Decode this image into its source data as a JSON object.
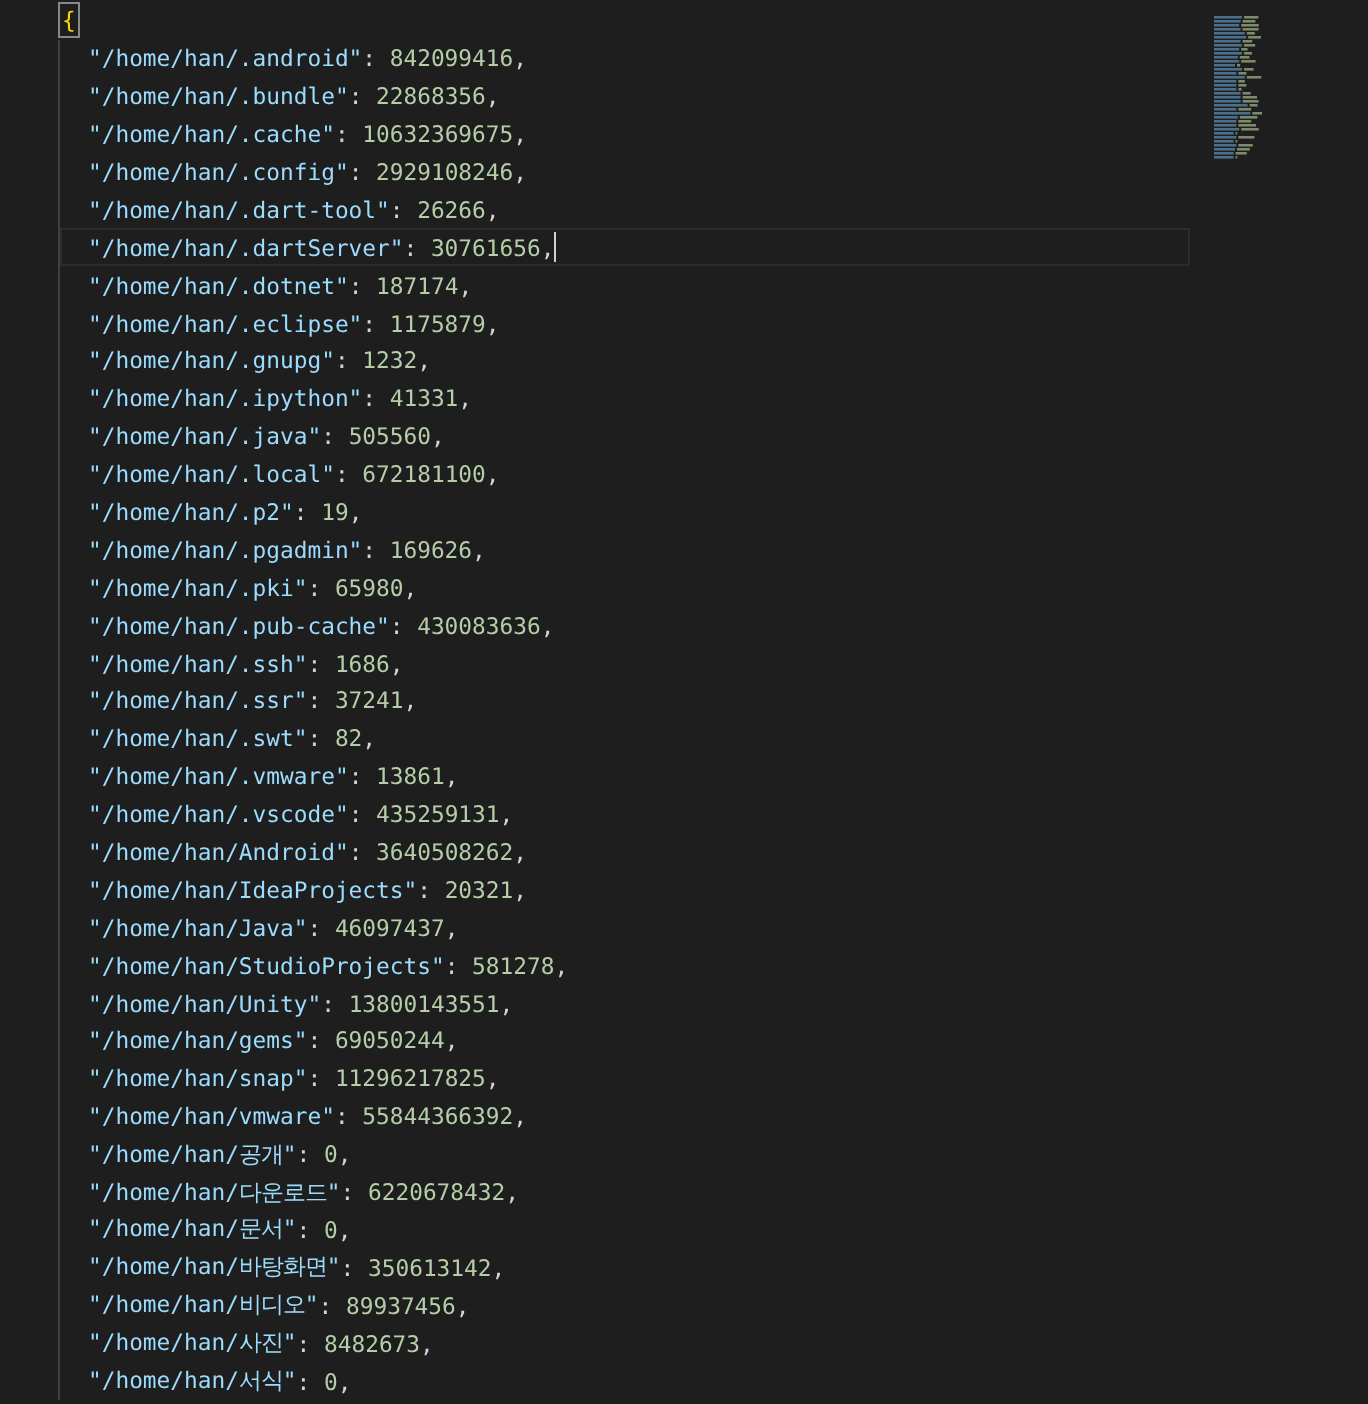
{
  "editor": {
    "open_brace": "{",
    "entries": [
      {
        "key": "\"/home/han/.android\"",
        "colon": ":",
        "value": "842099416",
        "comma": ",",
        "active": false
      },
      {
        "key": "\"/home/han/.bundle\"",
        "colon": ":",
        "value": "22868356",
        "comma": ",",
        "active": false
      },
      {
        "key": "\"/home/han/.cache\"",
        "colon": ":",
        "value": "10632369675",
        "comma": ",",
        "active": false
      },
      {
        "key": "\"/home/han/.config\"",
        "colon": ":",
        "value": "2929108246",
        "comma": ",",
        "active": false
      },
      {
        "key": "\"/home/han/.dart-tool\"",
        "colon": ":",
        "value": "26266",
        "comma": ",",
        "active": false
      },
      {
        "key": "\"/home/han/.dartServer\"",
        "colon": ":",
        "value": "30761656",
        "comma": ",",
        "active": true
      },
      {
        "key": "\"/home/han/.dotnet\"",
        "colon": ":",
        "value": "187174",
        "comma": ",",
        "active": false
      },
      {
        "key": "\"/home/han/.eclipse\"",
        "colon": ":",
        "value": "1175879",
        "comma": ",",
        "active": false
      },
      {
        "key": "\"/home/han/.gnupg\"",
        "colon": ":",
        "value": "1232",
        "comma": ",",
        "active": false
      },
      {
        "key": "\"/home/han/.ipython\"",
        "colon": ":",
        "value": "41331",
        "comma": ",",
        "active": false
      },
      {
        "key": "\"/home/han/.java\"",
        "colon": ":",
        "value": "505560",
        "comma": ",",
        "active": false
      },
      {
        "key": "\"/home/han/.local\"",
        "colon": ":",
        "value": "672181100",
        "comma": ",",
        "active": false
      },
      {
        "key": "\"/home/han/.p2\"",
        "colon": ":",
        "value": "19",
        "comma": ",",
        "active": false
      },
      {
        "key": "\"/home/han/.pgadmin\"",
        "colon": ":",
        "value": "169626",
        "comma": ",",
        "active": false
      },
      {
        "key": "\"/home/han/.pki\"",
        "colon": ":",
        "value": "65980",
        "comma": ",",
        "active": false
      },
      {
        "key": "\"/home/han/.pub-cache\"",
        "colon": ":",
        "value": "430083636",
        "comma": ",",
        "active": false
      },
      {
        "key": "\"/home/han/.ssh\"",
        "colon": ":",
        "value": "1686",
        "comma": ",",
        "active": false
      },
      {
        "key": "\"/home/han/.ssr\"",
        "colon": ":",
        "value": "37241",
        "comma": ",",
        "active": false
      },
      {
        "key": "\"/home/han/.swt\"",
        "colon": ":",
        "value": "82",
        "comma": ",",
        "active": false
      },
      {
        "key": "\"/home/han/.vmware\"",
        "colon": ":",
        "value": "13861",
        "comma": ",",
        "active": false
      },
      {
        "key": "\"/home/han/.vscode\"",
        "colon": ":",
        "value": "435259131",
        "comma": ",",
        "active": false
      },
      {
        "key": "\"/home/han/Android\"",
        "colon": ":",
        "value": "3640508262",
        "comma": ",",
        "active": false
      },
      {
        "key": "\"/home/han/IdeaProjects\"",
        "colon": ":",
        "value": "20321",
        "comma": ",",
        "active": false
      },
      {
        "key": "\"/home/han/Java\"",
        "colon": ":",
        "value": "46097437",
        "comma": ",",
        "active": false
      },
      {
        "key": "\"/home/han/StudioProjects\"",
        "colon": ":",
        "value": "581278",
        "comma": ",",
        "active": false
      },
      {
        "key": "\"/home/han/Unity\"",
        "colon": ":",
        "value": "13800143551",
        "comma": ",",
        "active": false
      },
      {
        "key": "\"/home/han/gems\"",
        "colon": ":",
        "value": "69050244",
        "comma": ",",
        "active": false
      },
      {
        "key": "\"/home/han/snap\"",
        "colon": ":",
        "value": "11296217825",
        "comma": ",",
        "active": false
      },
      {
        "key": "\"/home/han/vmware\"",
        "colon": ":",
        "value": "55844366392",
        "comma": ",",
        "active": false
      },
      {
        "key": "\"/home/han/공개\"",
        "colon": ":",
        "value": "0",
        "comma": ",",
        "active": false
      },
      {
        "key": "\"/home/han/다운로드\"",
        "colon": ":",
        "value": "6220678432",
        "comma": ",",
        "active": false
      },
      {
        "key": "\"/home/han/문서\"",
        "colon": ":",
        "value": "0",
        "comma": ",",
        "active": false
      },
      {
        "key": "\"/home/han/바탕화면\"",
        "colon": ":",
        "value": "350613142",
        "comma": ",",
        "active": false
      },
      {
        "key": "\"/home/han/비디오\"",
        "colon": ":",
        "value": "89937456",
        "comma": ",",
        "active": false
      },
      {
        "key": "\"/home/han/사진\"",
        "colon": ":",
        "value": "8482673",
        "comma": ",",
        "active": false
      },
      {
        "key": "\"/home/han/서식\"",
        "colon": ":",
        "value": "0",
        "comma": ",",
        "active": false
      }
    ]
  }
}
